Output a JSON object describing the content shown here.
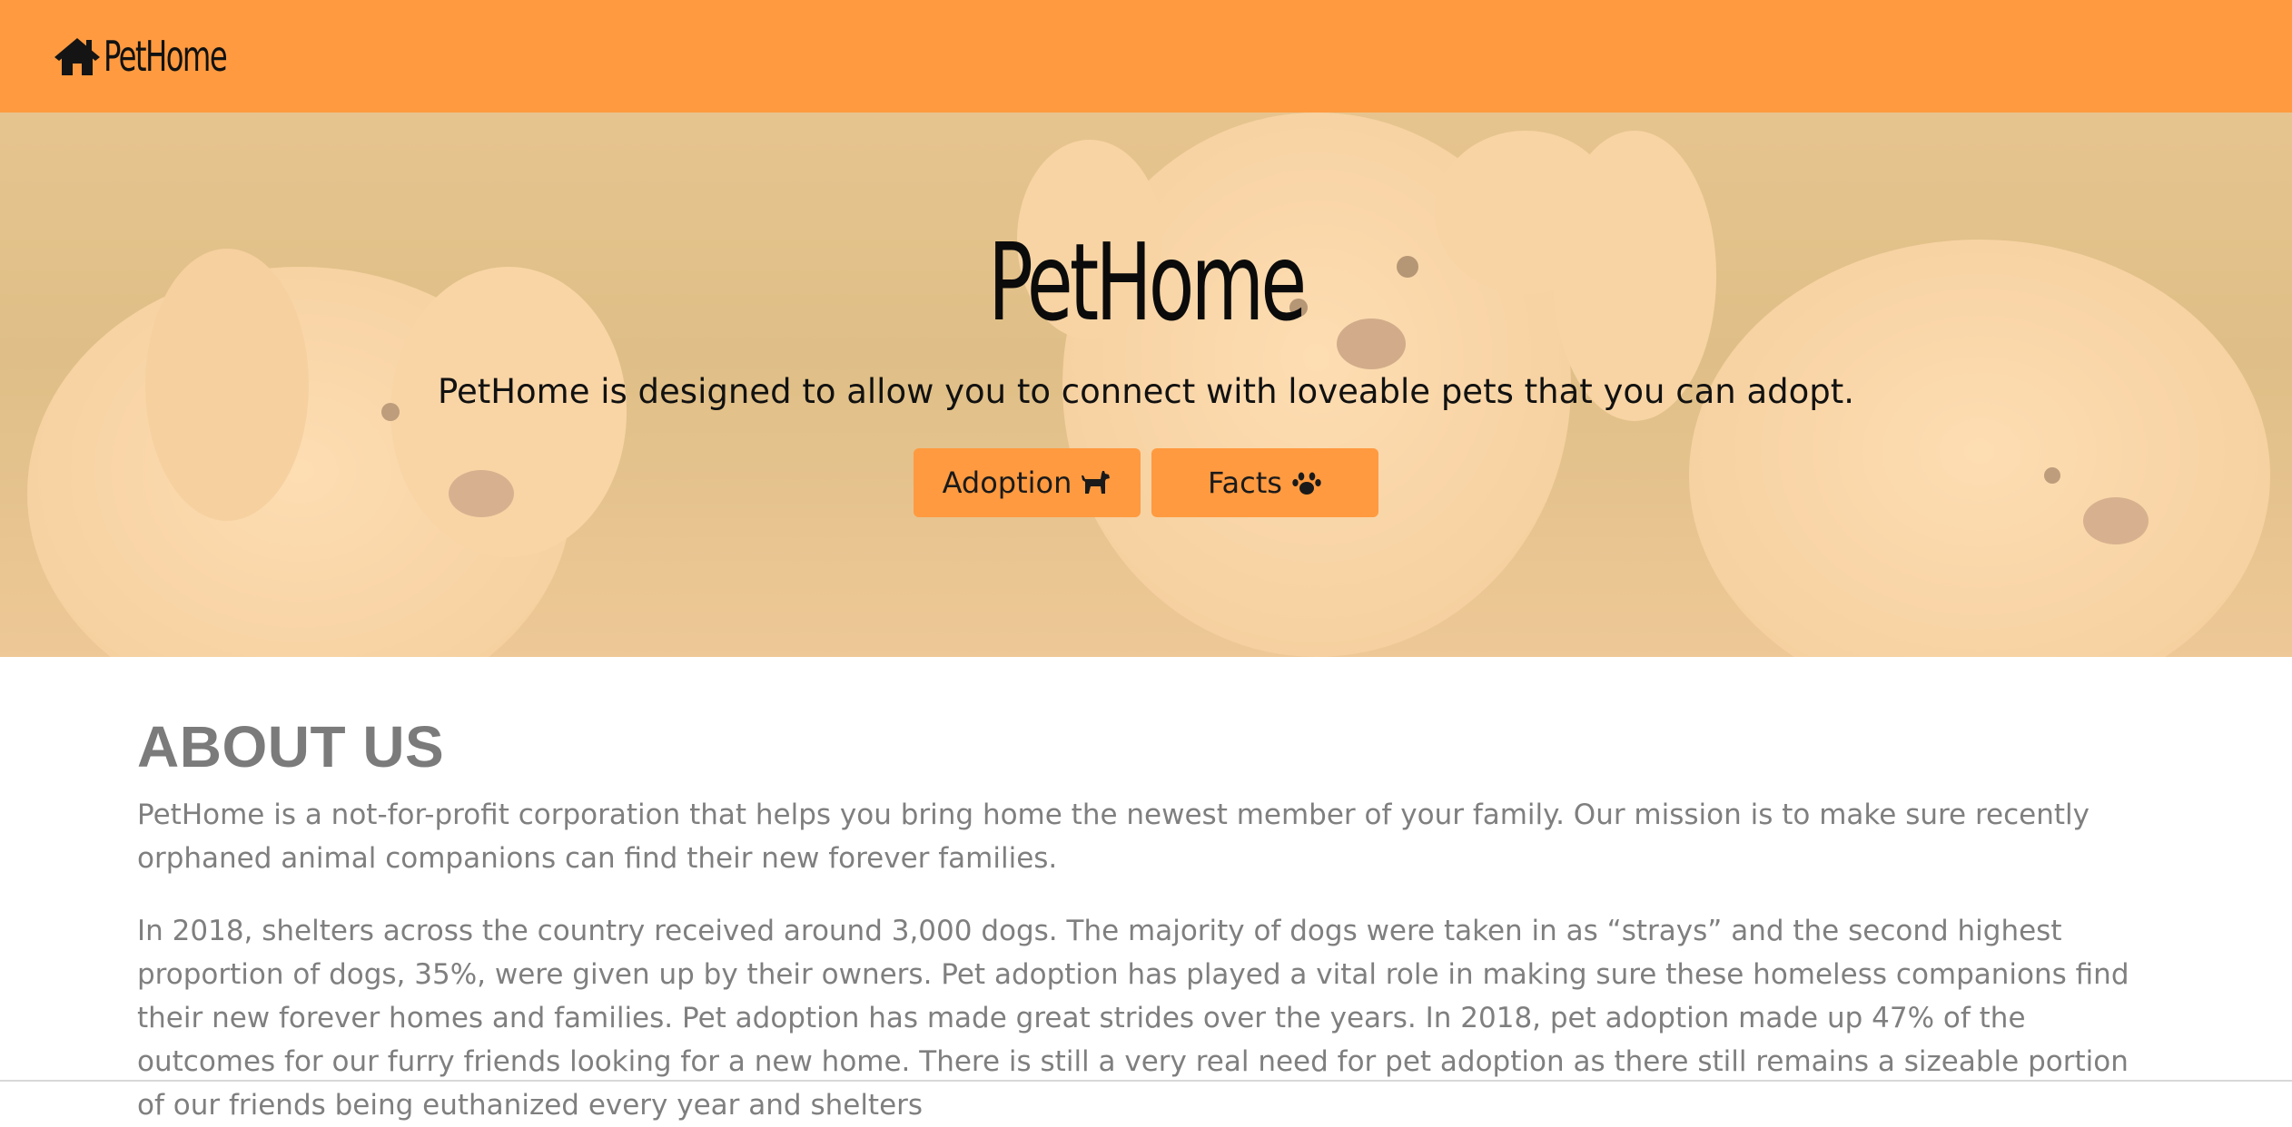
{
  "navbar": {
    "brand_icon": "home-icon",
    "brand_text": "PetHome",
    "background_color": "#ff9a40"
  },
  "hero": {
    "title": "PetHome",
    "subtitle": "PetHome is designed to allow you to connect with loveable pets that you can adopt.",
    "buttons": [
      {
        "label": "Adoption",
        "icon": "dog-icon"
      },
      {
        "label": "Facts",
        "icon": "paw-icon"
      }
    ]
  },
  "about": {
    "heading": "ABOUT US",
    "paragraphs": [
      "PetHome is a not-for-profit corporation that helps you bring home the newest member of your family. Our mission is to make sure recently orphaned animal companions can find their new forever families.",
      "In 2018, shelters across the country received around 3,000 dogs. The majority of dogs were taken in as “strays” and the second highest proportion of dogs, 35%, were given up by their owners. Pet adoption has played a vital role in making sure these homeless companions find their new forever homes and families. Pet adoption has made great strides over the years. In 2018, pet adoption made up 47% of the outcomes for our furry friends looking for a new home. There is still a very real need for pet adoption as there still remains a sizeable portion of our friends being euthanized every year and shelters"
    ]
  },
  "colors": {
    "accent": "#ff9a40",
    "text_muted": "#7f7f7f"
  }
}
